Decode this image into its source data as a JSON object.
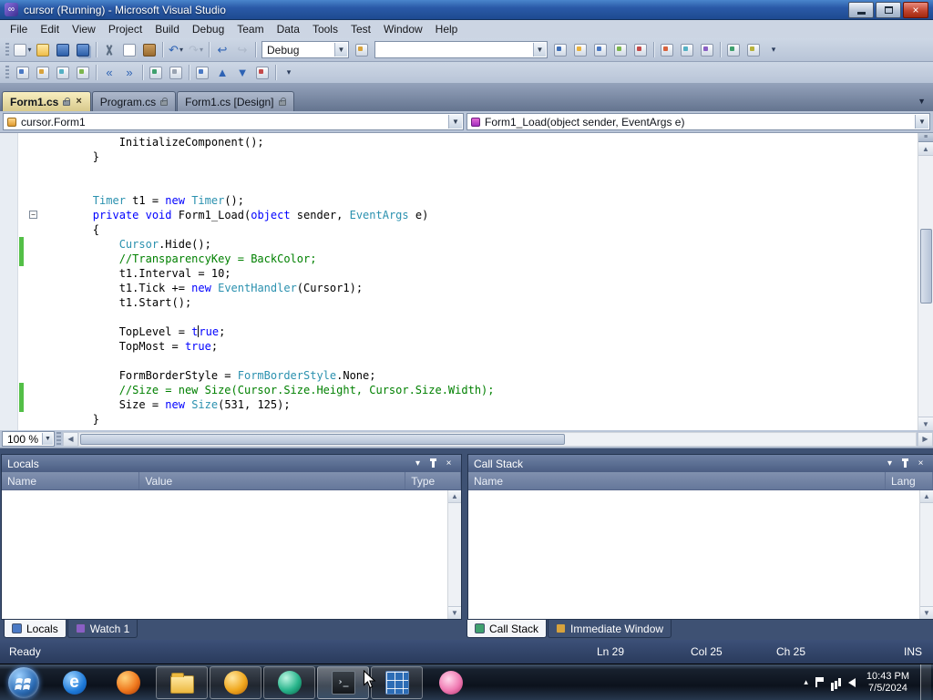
{
  "window": {
    "title": "cursor (Running) - Microsoft Visual Studio",
    "app_icon_glyph": "∞"
  },
  "menubar": {
    "items": [
      "File",
      "Edit",
      "View",
      "Project",
      "Build",
      "Debug",
      "Team",
      "Data",
      "Tools",
      "Test",
      "Window",
      "Help"
    ]
  },
  "toolbar1": {
    "config_value": "Debug",
    "search_value": "",
    "left_icons": [
      {
        "name": "new-item-button",
        "cls": "page",
        "arrow": true
      },
      {
        "name": "open-file-button",
        "cls": "folder"
      },
      {
        "name": "save-button",
        "cls": "floppy"
      },
      {
        "name": "save-all-button",
        "cls": "floppy2"
      },
      {
        "sep": true
      },
      {
        "name": "cut-button",
        "cls": "cut"
      },
      {
        "name": "copy-button",
        "cls": "copy"
      },
      {
        "name": "paste-button",
        "cls": "paste"
      },
      {
        "sep": true
      },
      {
        "name": "undo-button",
        "glyph": "↶",
        "cls": "glyph-blue",
        "arrow": true
      },
      {
        "name": "redo-button",
        "glyph": "↷",
        "cls": "glyph-gray",
        "arrow": true,
        "disabled": true
      },
      {
        "sep": true
      },
      {
        "name": "navigate-backward-button",
        "glyph": "↩",
        "cls": "glyph-blue"
      },
      {
        "name": "navigate-forward-button",
        "glyph": "↪",
        "cls": "glyph-gray",
        "disabled": true
      },
      {
        "sep": true
      }
    ],
    "mid_icons": [
      {
        "name": "find-in-files-button",
        "cls": "plain",
        "accent": "#d8a33c"
      }
    ],
    "right_icons": [
      {
        "name": "quick-find-button",
        "cls": "plain",
        "accent": "#3f6fb8"
      },
      {
        "name": "solution-explorer-button",
        "cls": "plain",
        "accent": "#e9b23d"
      },
      {
        "name": "properties-window-button",
        "cls": "plain",
        "accent": "#4a79c4"
      },
      {
        "name": "object-browser-button",
        "cls": "plain",
        "accent": "#7cb64e"
      },
      {
        "name": "toolbox-button",
        "cls": "plain",
        "accent": "#c44a4a"
      },
      {
        "sep": true
      },
      {
        "name": "error-list-button",
        "cls": "plain",
        "accent": "#d8623c"
      },
      {
        "name": "command-window-button",
        "cls": "plain",
        "accent": "#54b0c4"
      },
      {
        "name": "immediate-window-button",
        "cls": "plain",
        "accent": "#8a5fc4"
      },
      {
        "sep": true
      },
      {
        "name": "extension-manager-button",
        "cls": "plain",
        "accent": "#3fa06e"
      },
      {
        "name": "start-page-button",
        "cls": "plain",
        "accent": "#b8b23c"
      },
      {
        "name": "toolbar-options-button",
        "glyph": "▾",
        "cls": "chevron"
      }
    ]
  },
  "toolbar2": {
    "icons": [
      {
        "name": "display-object-member-list-button",
        "cls": "plain",
        "accent": "#4a79c4"
      },
      {
        "name": "display-parameter-info-button",
        "cls": "plain",
        "accent": "#d8a33c"
      },
      {
        "name": "display-quick-info-button",
        "cls": "plain",
        "accent": "#54b0c4"
      },
      {
        "name": "display-word-completion-button",
        "cls": "plain",
        "accent": "#7cb64e"
      },
      {
        "sep": true
      },
      {
        "name": "decrease-indent-button",
        "glyph": "«",
        "cls": "glyph-blue"
      },
      {
        "name": "increase-indent-button",
        "glyph": "»",
        "cls": "glyph-blue"
      },
      {
        "sep": true
      },
      {
        "name": "comment-selection-button",
        "cls": "plain",
        "accent": "#3fa06e"
      },
      {
        "name": "uncomment-selection-button",
        "cls": "plain",
        "accent": "#9aa4b2"
      },
      {
        "sep": true
      },
      {
        "name": "toggle-bookmark-button",
        "cls": "plain",
        "accent": "#4a79c4"
      },
      {
        "name": "previous-bookmark-button",
        "glyph": "▲",
        "cls": "glyph-blue"
      },
      {
        "name": "next-bookmark-button",
        "glyph": "▼",
        "cls": "glyph-blue"
      },
      {
        "name": "clear-bookmarks-button",
        "cls": "plain",
        "accent": "#c44a4a"
      },
      {
        "sep": true
      },
      {
        "name": "toolbar-options-button",
        "glyph": "▾",
        "cls": "chevron"
      }
    ]
  },
  "tabs": {
    "items": [
      {
        "label": "Form1.cs",
        "locked": true,
        "active": true
      },
      {
        "label": "Program.cs",
        "locked": true
      },
      {
        "label": "Form1.cs [Design]",
        "locked": true
      }
    ]
  },
  "navbar": {
    "scope": "cursor.Form1",
    "member": "Form1_Load(object sender, EventArgs e)"
  },
  "editor": {
    "zoom": "100 %",
    "lines": [
      {
        "tokens": [
          [
            "d",
            "            InitializeComponent();"
          ]
        ]
      },
      {
        "tokens": [
          [
            "d",
            "        }"
          ]
        ]
      },
      {
        "tokens": [
          [
            "d",
            ""
          ]
        ]
      },
      {
        "tokens": [
          [
            "d",
            ""
          ]
        ]
      },
      {
        "tokens": [
          [
            "d",
            "        "
          ],
          [
            "y",
            "Timer"
          ],
          [
            "d",
            " t1 = "
          ],
          [
            "k",
            "new"
          ],
          [
            "d",
            " "
          ],
          [
            "y",
            "Timer"
          ],
          [
            "d",
            "();"
          ]
        ]
      },
      {
        "tokens": [
          [
            "d",
            "        "
          ],
          [
            "k",
            "private"
          ],
          [
            "d",
            " "
          ],
          [
            "k",
            "void"
          ],
          [
            "d",
            " Form1_Load("
          ],
          [
            "k",
            "object"
          ],
          [
            "d",
            " sender, "
          ],
          [
            "y",
            "EventArgs"
          ],
          [
            "d",
            " e)"
          ]
        ],
        "collapse": true
      },
      {
        "tokens": [
          [
            "d",
            "        {"
          ]
        ]
      },
      {
        "tokens": [
          [
            "d",
            "            "
          ],
          [
            "y",
            "Cursor"
          ],
          [
            "d",
            ".Hide();"
          ]
        ],
        "changed": true
      },
      {
        "tokens": [
          [
            "d",
            "            "
          ],
          [
            "m",
            "//TransparencyKey = BackColor;"
          ]
        ],
        "changed": true
      },
      {
        "tokens": [
          [
            "d",
            "            t1.Interval = 10;"
          ]
        ]
      },
      {
        "tokens": [
          [
            "d",
            "            t1.Tick += "
          ],
          [
            "k",
            "new"
          ],
          [
            "d",
            " "
          ],
          [
            "y",
            "EventHandler"
          ],
          [
            "d",
            "(Cursor1);"
          ]
        ]
      },
      {
        "tokens": [
          [
            "d",
            "            t1.Start();"
          ]
        ]
      },
      {
        "tokens": [
          [
            "d",
            ""
          ]
        ]
      },
      {
        "tokens": [
          [
            "d",
            "            TopLevel = "
          ],
          [
            "k",
            "t"
          ],
          [
            "caret",
            ""
          ],
          [
            "k",
            "rue"
          ],
          [
            "d",
            ";"
          ]
        ]
      },
      {
        "tokens": [
          [
            "d",
            "            TopMost = "
          ],
          [
            "k",
            "true"
          ],
          [
            "d",
            ";"
          ]
        ]
      },
      {
        "tokens": [
          [
            "d",
            ""
          ]
        ]
      },
      {
        "tokens": [
          [
            "d",
            "            FormBorderStyle = "
          ],
          [
            "y",
            "FormBorderStyle"
          ],
          [
            "d",
            ".None;"
          ]
        ]
      },
      {
        "tokens": [
          [
            "d",
            "            "
          ],
          [
            "m",
            "//Size = new Size(Cursor.Size.Height, Cursor.Size.Width);"
          ]
        ],
        "changed": true
      },
      {
        "tokens": [
          [
            "d",
            "            Size = "
          ],
          [
            "k",
            "new"
          ],
          [
            "d",
            " "
          ],
          [
            "y",
            "Size"
          ],
          [
            "d",
            "(531, 125);"
          ]
        ],
        "changed": true
      },
      {
        "tokens": [
          [
            "d",
            "        }"
          ]
        ]
      }
    ]
  },
  "locals": {
    "title": "Locals",
    "columns": [
      "Name",
      "Value",
      "Type"
    ]
  },
  "callstack": {
    "title": "Call Stack",
    "columns": [
      "Name",
      "Lang"
    ]
  },
  "panel_buttons": [
    {
      "name": "window-position-button",
      "glyph": "▾"
    },
    {
      "name": "auto-hide-pin-button",
      "glyph": "pin"
    },
    {
      "name": "close-panel-button",
      "glyph": "×"
    }
  ],
  "panel_tabs": {
    "left": [
      {
        "label": "Locals",
        "active": true,
        "accent": "#4a79c4"
      },
      {
        "label": "Watch 1",
        "accent": "#8a5fc4"
      }
    ],
    "right": [
      {
        "label": "Call Stack",
        "active": true,
        "accent": "#3fa06e"
      },
      {
        "label": "Immediate Window",
        "accent": "#d8a33c"
      }
    ]
  },
  "statusbar": {
    "state": "Ready",
    "line": "Ln 29",
    "column": "Col 25",
    "character": "Ch 25",
    "mode": "INS"
  },
  "taskbar": {
    "clock_time": "10:43 PM",
    "clock_date": "7/5/2024",
    "items": [
      {
        "name": "taskbar-internet-explorer",
        "cls": "ie"
      },
      {
        "name": "taskbar-firefox",
        "cls": "firefox"
      },
      {
        "name": "taskbar-windows-explorer",
        "cls": "folder",
        "running": true
      },
      {
        "name": "taskbar-media-app",
        "cls": "media",
        "running": true
      },
      {
        "name": "taskbar-green-orb-app",
        "cls": "orb",
        "running": true
      },
      {
        "name": "taskbar-console-app",
        "cls": "console",
        "running": true,
        "active": true
      },
      {
        "name": "taskbar-grid-app",
        "cls": "grid",
        "running": true
      },
      {
        "name": "taskbar-flower-app",
        "cls": "flower"
      }
    ],
    "tray": [
      {
        "name": "notification-chevron-button",
        "glyph": "▴"
      },
      {
        "name": "action-center-flag-icon",
        "kind": "flag"
      },
      {
        "name": "network-icon",
        "kind": "net"
      },
      {
        "name": "volume-icon",
        "kind": "vol"
      }
    ]
  },
  "colors": {
    "keyword": "#0000ff",
    "type": "#2b91af",
    "comment": "#008000",
    "change_saved_bar": "#53bf47",
    "titlebar_blue": "#2a5aa8",
    "status_navy": "#2a3b5c"
  }
}
